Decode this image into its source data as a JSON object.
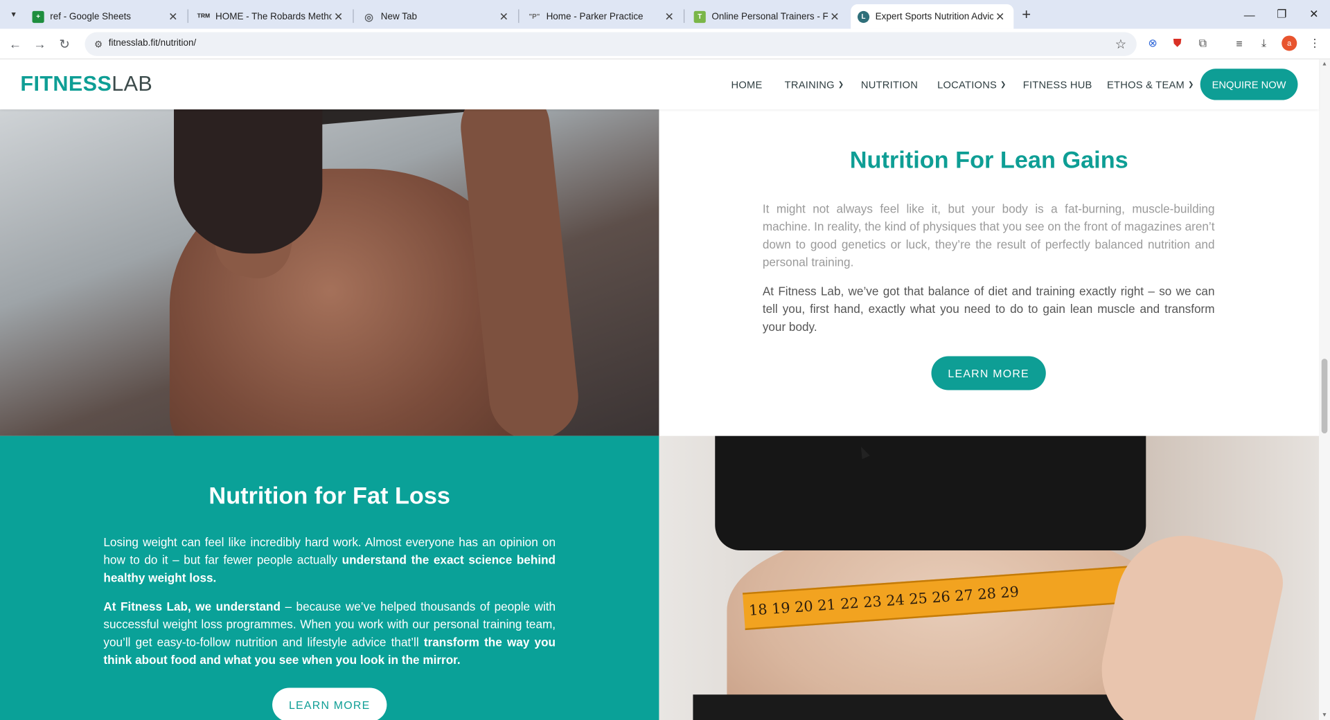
{
  "browser": {
    "tabs": [
      {
        "title": "ref - Google Sheets",
        "favicon_color": "#1e8e3e",
        "favicon_glyph": "+"
      },
      {
        "title": "HOME - The Robards Method",
        "favicon_color": "#222222",
        "favicon_glyph": "TRM"
      },
      {
        "title": "New Tab",
        "favicon_color": "#5f6368",
        "favicon_glyph": "◎"
      },
      {
        "title": "Home - Parker Practice",
        "favicon_color": "#666666",
        "favicon_glyph": "\"P\""
      },
      {
        "title": "Online Personal Trainers - Fitnes",
        "favicon_color": "#7ab648",
        "favicon_glyph": "T"
      },
      {
        "title": "Expert Sports Nutrition Advice |",
        "favicon_color": "#2f6f7a",
        "favicon_glyph": "L"
      }
    ],
    "active_tab": 5,
    "url": "fitnesslab.fit/nutrition/"
  },
  "site": {
    "logo_part1": "FITNESS",
    "logo_part2": "LAB",
    "nav": [
      {
        "label": "HOME",
        "dropdown": false
      },
      {
        "label": "TRAINING",
        "dropdown": true
      },
      {
        "label": "NUTRITION",
        "dropdown": false
      },
      {
        "label": "LOCATIONS",
        "dropdown": true
      },
      {
        "label": "FITNESS HUB",
        "dropdown": false
      },
      {
        "label": "ETHOS & TEAM",
        "dropdown": true
      }
    ],
    "enquire_label": "ENQUIRE NOW",
    "brand_color": "#0e9e95"
  },
  "lean": {
    "heading": "Nutrition For Lean Gains",
    "para1": "It might not always feel like it, but your body is a fat-burning, muscle-building machine. In reality, the kind of physiques that you see on the front of magazines aren’t down to good genetics or luck, they’re the result of perfectly balanced nutrition and personal training.",
    "para2": "At Fitness Lab, we’ve got that balance of diet and training exactly right – so we can tell you, first hand, exactly what you need to do to gain lean muscle and transform your body.",
    "button": "LEARN MORE"
  },
  "fat": {
    "heading": "Nutrition for Fat Loss",
    "para1_a": "Losing weight can feel like incredibly hard work. Almost everyone has an opinion on how to do it – but far fewer people actually ",
    "para1_b": "understand the exact science behind healthy weight loss.",
    "para2_a": "At Fitness Lab, we understand",
    "para2_b": " – because we’ve helped thousands of people with successful weight loss programmes. When you work with our personal training team, you’ll get easy-to-follow nutrition and lifestyle advice that’ll ",
    "para2_c": "transform the way you think about food and what you see when you look in the mirror.",
    "button": "LEARN MORE"
  },
  "tape_numbers": "18 19 20 21 22 23 24 25 26 27 28 29"
}
